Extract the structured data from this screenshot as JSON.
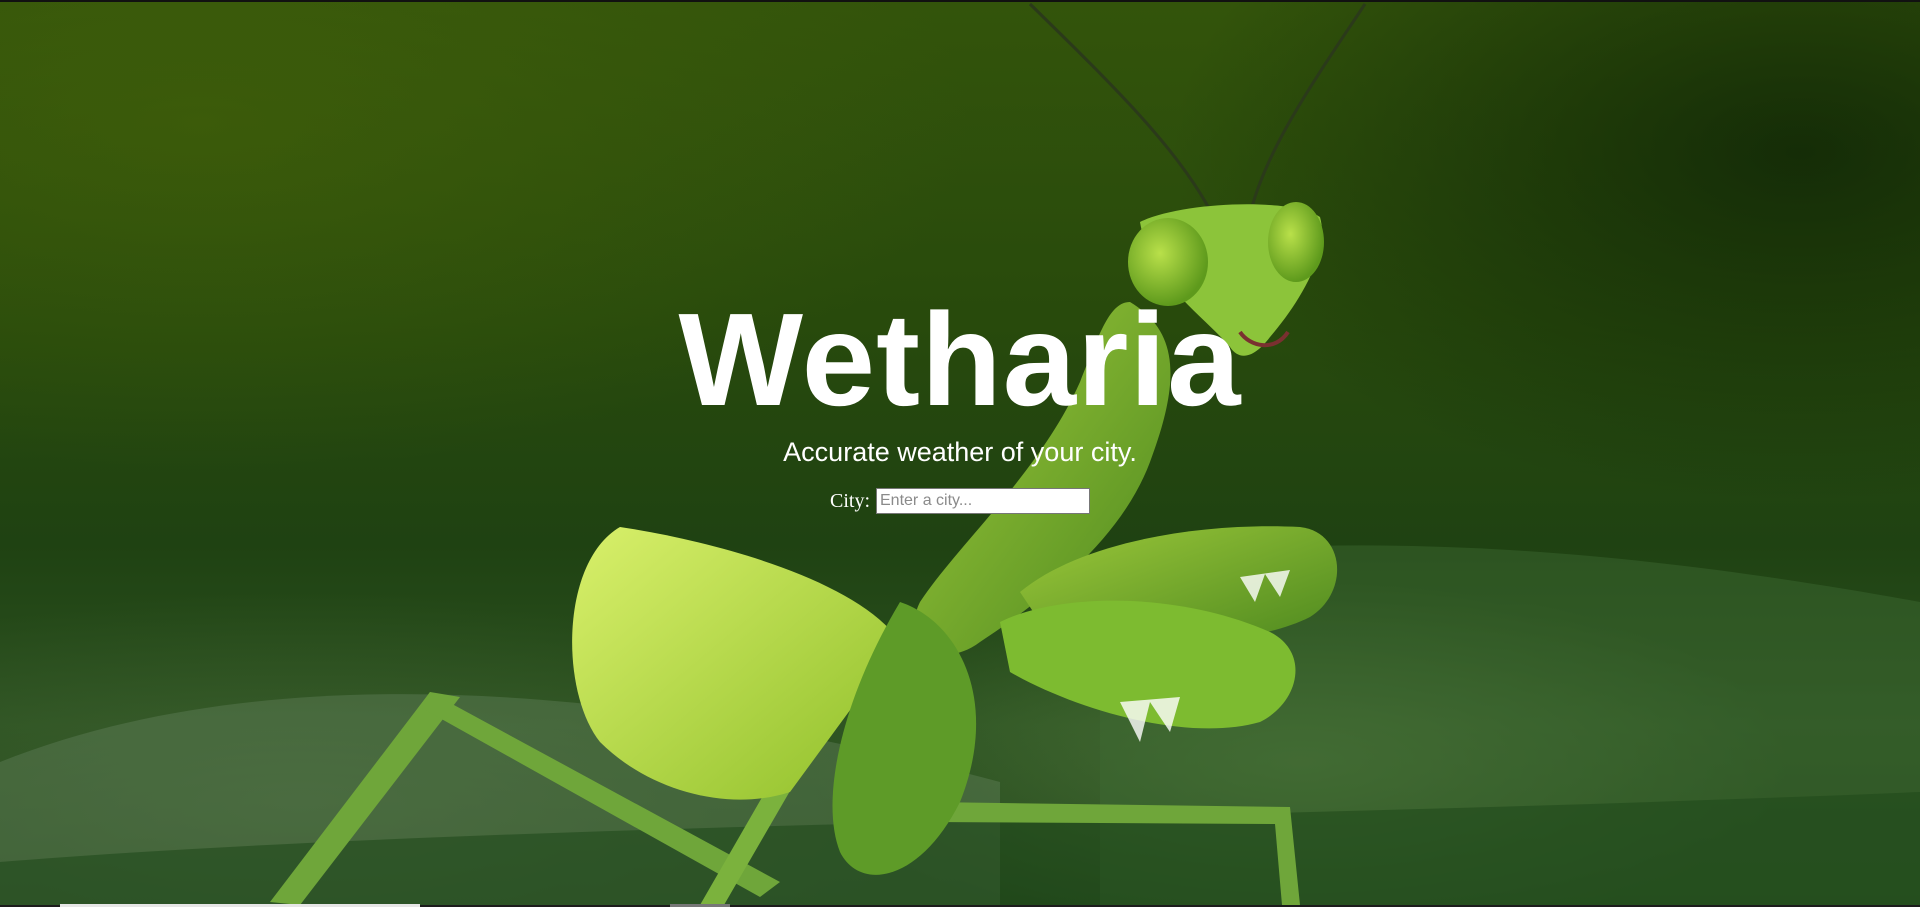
{
  "hero": {
    "title": "Wetharia",
    "tagline": "Accurate weather of your city."
  },
  "search": {
    "label": "City:",
    "placeholder": "Enter a city...",
    "value": ""
  },
  "colors": {
    "text": "#ffffff",
    "background_green": "#2c5221",
    "mantis_green": "#7fb42d"
  },
  "background_image": {
    "subject": "green praying mantis on leaf"
  }
}
